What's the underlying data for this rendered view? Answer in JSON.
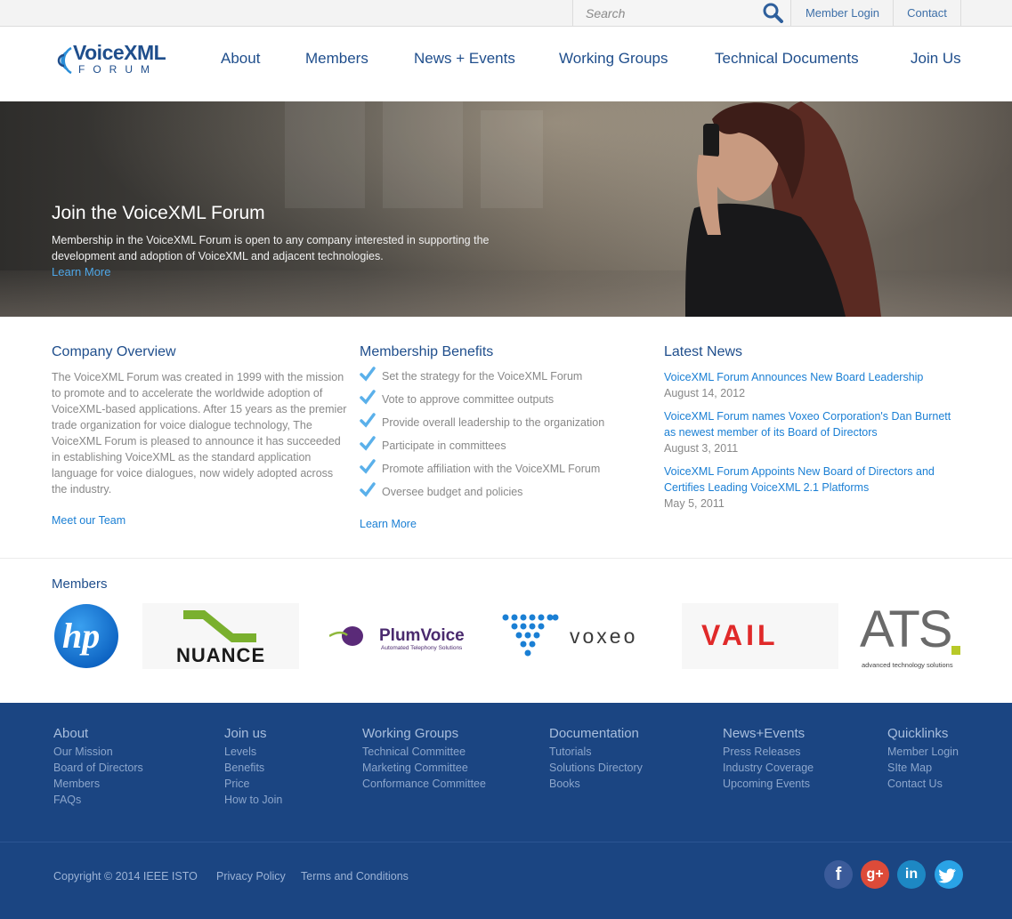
{
  "topbar": {
    "search_placeholder": "Search",
    "member_login": "Member Login",
    "contact": "Contact"
  },
  "logo": {
    "line1": "VoiceXML",
    "line2": "FORUM"
  },
  "nav": [
    "About",
    "Members",
    "News + Events",
    "Working Groups",
    "Technical Documents",
    "Join Us"
  ],
  "hero": {
    "title": "Join the VoiceXML Forum",
    "text": "Membership in the VoiceXML Forum is open to any company interested in supporting the development and adoption of VoiceXML and adjacent technologies.",
    "link": "Learn More"
  },
  "overview": {
    "title": "Company Overview",
    "text": "The VoiceXML Forum was created in 1999 with the mission to promote and to accelerate the worldwide adoption of VoiceXML-based applications. After 15 years as the premier trade organization for voice dialogue technology, The VoiceXML Forum is pleased to announce it has succeeded in establishing VoiceXML as the standard application language for voice dialogues, now widely adopted across the industry.",
    "link": "Meet our Team"
  },
  "benefits": {
    "title": "Membership Benefits",
    "items": [
      "Set the strategy for the VoiceXML Forum",
      "Vote to approve committee outputs",
      "Provide overall leadership to the organization",
      "Participate in committees",
      "Promote affiliation with the VoiceXML Forum",
      "Oversee budget and policies"
    ],
    "link": "Learn More"
  },
  "news": {
    "title": "Latest News",
    "items": [
      {
        "title": "VoiceXML Forum Announces New Board Leadership",
        "date": "August 14, 2012"
      },
      {
        "title": "VoiceXML Forum names Voxeo Corporation's Dan Burnett as newest member of its Board of Directors",
        "date": "August 3, 2011"
      },
      {
        "title": "VoiceXML Forum Appoints New Board of Directors and Certifies Leading VoiceXML 2.1 Platforms",
        "date": "May 5, 2011"
      }
    ]
  },
  "members": {
    "title": "Members",
    "logos": {
      "hp": "hp",
      "nuance": "NUANCE",
      "plumvoice": "PlumVoice",
      "plumvoice_sub": "Automated Telephony Solutions",
      "voxeo": "voxeo",
      "vail": "VAIL",
      "ats": "ATS",
      "ats_sub": "advanced technology solutions"
    }
  },
  "footer": {
    "columns": [
      {
        "head": "About",
        "items": [
          "Our Mission",
          "Board of Directors",
          "Members",
          "FAQs"
        ]
      },
      {
        "head": "Join us",
        "items": [
          "Levels",
          "Benefits",
          "Price",
          "How to Join"
        ]
      },
      {
        "head": "Working Groups",
        "items": [
          "Technical Committee",
          "Marketing Committee",
          "Conformance Committee"
        ]
      },
      {
        "head": "Documentation",
        "items": [
          "Tutorials",
          "Solutions Directory",
          "Books"
        ]
      },
      {
        "head": "News+Events",
        "items": [
          "Press Releases",
          "Industry Coverage",
          "Upcoming Events"
        ]
      },
      {
        "head": "Quicklinks",
        "items": [
          "Member Login",
          "SIte Map",
          "Contact Us"
        ]
      }
    ],
    "copyright": "Copyright © 2014 IEEE ISTO",
    "privacy": "Privacy Policy",
    "terms": "Terms and Conditions",
    "social": {
      "facebook": "f",
      "googleplus": "g+",
      "linkedin": "in",
      "twitter": "t"
    }
  },
  "colors": {
    "brand_blue": "#1f4e8c",
    "link_blue": "#1a7fd4",
    "footer_bg": "#1b4582",
    "check_blue": "#5ab0ea"
  }
}
